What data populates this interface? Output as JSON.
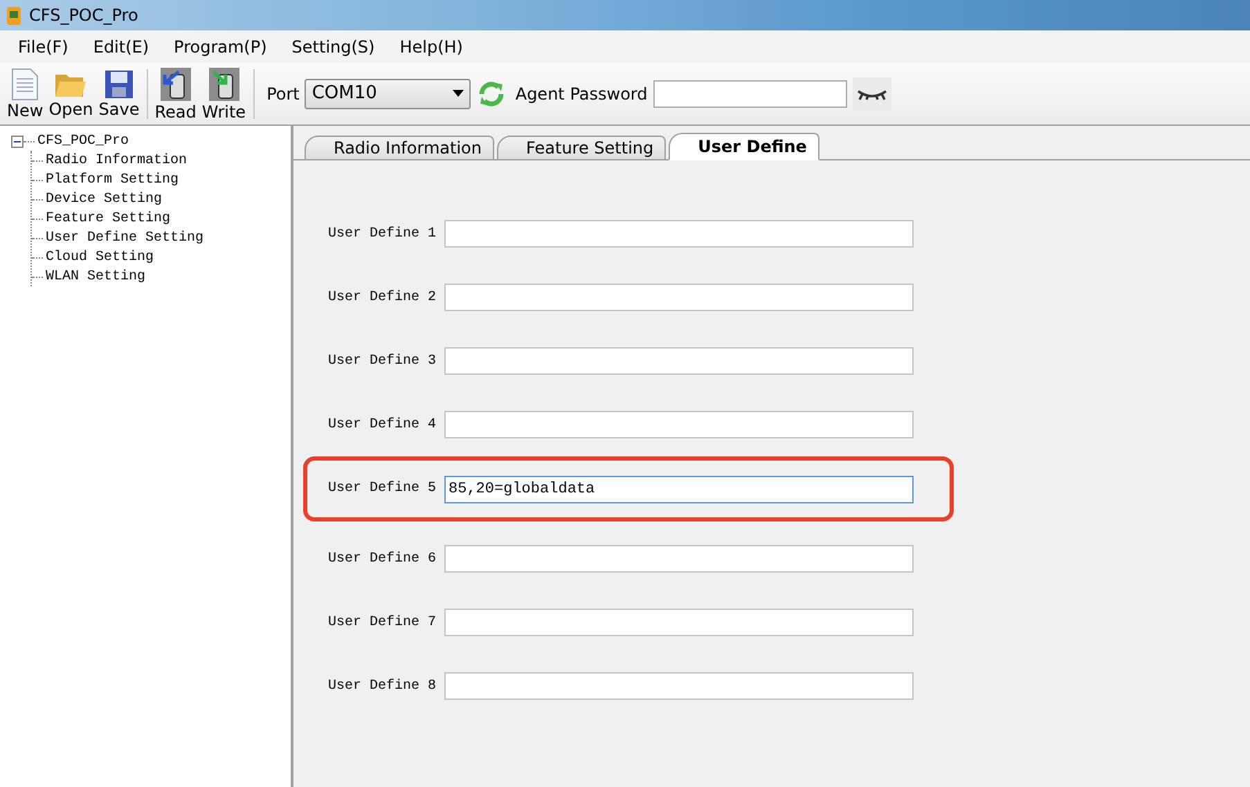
{
  "window": {
    "title": "CFS_POC_Pro"
  },
  "menu": [
    "File(F)",
    "Edit(E)",
    "Program(P)",
    "Setting(S)",
    "Help(H)"
  ],
  "toolbar": [
    {
      "kind": "new",
      "label": "New"
    },
    {
      "kind": "open",
      "label": "Open"
    },
    {
      "kind": "save",
      "label": "Save"
    },
    {
      "kind": "read",
      "label": "Read"
    },
    {
      "kind": "write",
      "label": "Write"
    }
  ],
  "port": {
    "label": "Port",
    "value": "COM10"
  },
  "agent_password": {
    "label": "Agent Password"
  },
  "tree": {
    "label": "CFS_POC_Pro",
    "expanded": true,
    "children": [
      {
        "label": "Radio Information"
      },
      {
        "label": "Platform Setting"
      },
      {
        "label": "Device Setting"
      },
      {
        "label": "Feature Setting"
      },
      {
        "label": "User Define Setting"
      },
      {
        "label": "Cloud Setting"
      },
      {
        "label": "WLAN Setting"
      }
    ]
  },
  "tabs": [
    {
      "label": "Radio Information",
      "selected": false
    },
    {
      "label": "Feature Setting",
      "selected": false
    },
    {
      "label": "User Define",
      "selected": true
    }
  ],
  "fields": [
    {
      "label": "User Define 1",
      "highlighted": false
    },
    {
      "label": "User Define 2",
      "highlighted": false
    },
    {
      "label": "User Define 3",
      "highlighted": false
    },
    {
      "label": "User Define 4",
      "highlighted": false
    },
    {
      "label": "User Define 5",
      "value": "85,20=globaldata",
      "highlighted": true
    },
    {
      "label": "User Define 6",
      "highlighted": false
    },
    {
      "label": "User Define 7",
      "highlighted": false
    },
    {
      "label": "User Define 8",
      "highlighted": false
    }
  ]
}
